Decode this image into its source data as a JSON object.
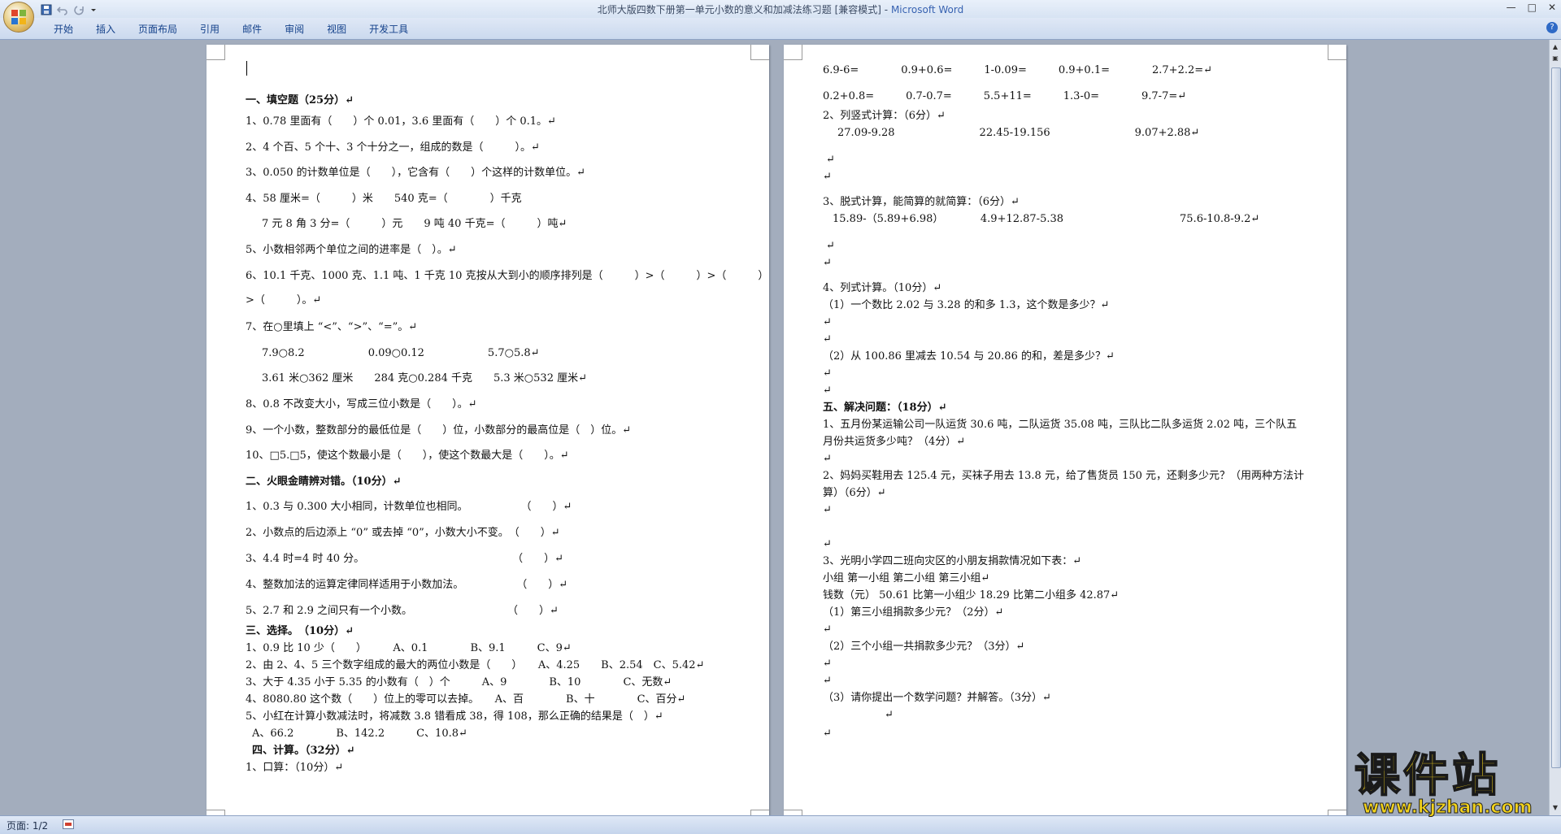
{
  "window": {
    "title": "北师大版四数下册第一单元小数的意义和加减法练习题 [兼容模式]",
    "title_sep": " - ",
    "app_name": "Microsoft Word"
  },
  "quick_access": [
    "save-icon",
    "undo-icon",
    "redo-icon",
    "customize-icon"
  ],
  "ribbon_tabs": [
    "开始",
    "插入",
    "页面布局",
    "引用",
    "邮件",
    "审阅",
    "视图",
    "开发工具"
  ],
  "page1": {
    "lines": [
      "一、填空题（25分）↵",
      "1、0.78 里面有（　　）个 0.01，3.6 里面有（　　）个 0.1。↵",
      "2、4 个百、5 个十、3 个十分之一，组成的数是（　　　）。↵",
      "3、0.050 的计数单位是（　　），它含有（　　）个这样的计数单位。↵",
      "4、58 厘米=（　　　）米　　540 克=（　　　　）千克",
      "7 元 8 角 3 分=（　　　）元　　9 吨 40 千克=（　　　）吨↵",
      "5、小数相邻两个单位之间的进率是（　）。↵",
      "6、10.1 千克、1000 克、1.1 吨、1 千克 10 克按从大到小的顺序排列是（　　　）>（　　　）>（　　　）",
      ">（　　　）。↵",
      "7、在○里填上 “<”、“>”、“=”。↵",
      "7.9○8.2　　　　　　0.09○0.12　　　　　　5.7○5.8↵",
      "3.61 米○362 厘米　　284 克○0.284 千克　　5.3 米○532 厘米↵",
      "8、0.8 不改变大小，写成三位小数是（　　）。↵",
      "9、一个小数，整数部分的最低位是（　　）位，小数部分的最高位是（　）位。↵",
      "10、□5.□5，使这个数最小是（　　），使这个数最大是（　　）。↵",
      "二、火眼金睛辨对错。（10分）↵",
      "1、0.3 与 0.300 大小相同，计数单位也相同。　　　　　　（　　）↵",
      "2、小数点的后边添上 “0” 或去掉 “0”，小数大小不变。　（　　）↵",
      "3、4.4 时=4 时 40 分。　　　　　　　　　　　　　　　（　　）↵",
      "4、整数加法的运算定律同样适用于小数加法。　　　　　　（　　）↵",
      "5、2.7 和 2.9 之间只有一个小数。　　　　　　　　　　（　　）↵",
      "三、选择。　（10分）↵",
      "1、0.9 比 10 少（　　）　　　A、0.1　　　　B、9.1　　　C、9↵",
      "2、由 2、4、5 三个数字组成的最大的两位小数是（　　）　　A、4.25　　B、2.54　C、5.42↵",
      "3、大于 4.35 小于 5.35 的小数有（　）个　　　A、9　　　　B、10　　　　C、无数↵",
      "4、8080.80 这个数（　　）位上的零可以去掉。　　A、百　　　　B、十　　　　C、百分↵",
      "5、小红在计算小数减法时，将减数 3.8 错看成 38，得 108，那么正确的结果是（　）↵",
      "A、66.2　　　　B、142.2　　　C、10.8↵",
      "四、计算。（32分）↵",
      "1、口算：（10分）↵"
    ]
  },
  "page2": {
    "lines": [
      "6.9-6=　　　　0.9+0.6=　　　1-0.09=　　　0.9+0.1=　　　　2.7+2.2=↵",
      "0.2+0.8=　　　0.7-0.7=　　　5.5+11=　　　1.3-0=　　　　9.7-7=↵",
      "2、列竖式计算：（6分）↵",
      "27.09-9.28　　　　　　　　22.45-19.156　　　　　　　　9.07+2.88↵",
      "3、脱式计算，能简算的就简算：（6分）↵",
      "15.89-（5.89+6.98）　　　　4.9+12.87-5.38　　　　　　　　　　　75.6-10.8-9.2↵",
      "4、列式计算。（10分）↵",
      "（1）一个数比 2.02 与 3.28 的和多 1.3，这个数是多少？↵",
      "（2）从 100.86 里减去 10.54 与 20.86 的和，差是多少？↵",
      "五、解决问题：（18分）↵",
      "1、五月份某运输公司一队运货 30.6 吨，二队运货 35.08 吨，三队比二队多运货 2.02 吨，三个队五",
      "月份共运货多少吨？（4分）↵",
      "2、妈妈买鞋用去 125.4 元，买袜子用去 13.8 元，给了售货员 150 元，还剩多少元？（用两种方法计",
      "算）（6分）↵",
      "3、光明小学四二班向灾区的小朋友捐款情况如下表：↵",
      "小组 第一小组 第二小组 第三小组↵",
      "钱数（元） 50.61 比第一小组少 18.29 比第二小组多 42.87↵",
      "（1）第三小组捐款多少元？（2分）↵",
      "（2）三个小组一共捐款多少元？（3分）↵",
      "（3）请你提出一个数学问题？并解答。（3分）↵"
    ],
    "marks": [
      "↵"
    ]
  },
  "status": {
    "page_info": "页面: 1/2"
  },
  "watermark": {
    "main": "课件站",
    "url": "www.kjzhan.com"
  }
}
